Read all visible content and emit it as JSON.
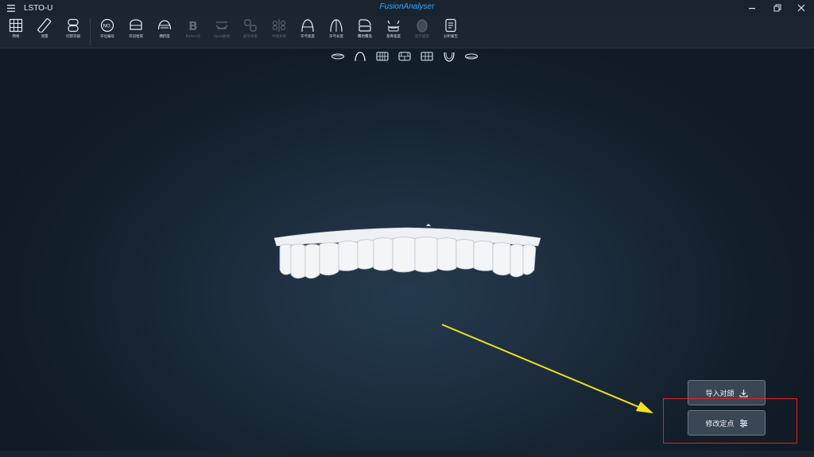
{
  "window": {
    "title": "LSTO-U",
    "brand": "FusionAnalyser",
    "controls": [
      "minimize-icon",
      "restore-icon",
      "close-icon"
    ]
  },
  "toolbar": {
    "items": [
      {
        "label": "网格",
        "icon": "grid-icon",
        "enabled": true
      },
      {
        "label": "测量",
        "icon": "ruler-icon",
        "enabled": true
      },
      {
        "label": "切割牙龈",
        "icon": "cut-gum-icon",
        "enabled": true
      },
      {
        "label": "牙位编号",
        "icon": "tooth-number-icon",
        "enabled": true
      },
      {
        "label": "牙冠拾取",
        "icon": "crown-pick-icon",
        "enabled": true
      },
      {
        "label": "拥挤度",
        "icon": "crowding-icon",
        "enabled": true
      },
      {
        "label": "Bolton比",
        "icon": "bolton-icon",
        "enabled": false
      },
      {
        "label": "Spee曲线",
        "icon": "spee-curve-icon",
        "enabled": false
      },
      {
        "label": "磨牙关系",
        "icon": "molar-relation-icon",
        "enabled": false
      },
      {
        "label": "中线关系",
        "icon": "midline-icon",
        "enabled": false
      },
      {
        "label": "牙弓宽度",
        "icon": "arch-width-icon",
        "enabled": true
      },
      {
        "label": "牙弓长度",
        "icon": "arch-length-icon",
        "enabled": true
      },
      {
        "label": "覆殆覆盖",
        "icon": "overbite-icon",
        "enabled": true
      },
      {
        "label": "基骨弧度",
        "icon": "basal-bone-icon",
        "enabled": true
      },
      {
        "label": "显示面部",
        "icon": "face-icon",
        "enabled": false
      },
      {
        "label": "分析报告",
        "icon": "report-icon",
        "enabled": true
      }
    ]
  },
  "views": [
    "view-bottom-icon",
    "view-arch-icon",
    "view-front-icon",
    "view-side-icon",
    "view-back-icon",
    "view-occlusal-icon",
    "view-top-icon"
  ],
  "actions": {
    "import_label": "导入对颌",
    "modify_label": "修改定点"
  },
  "colors": {
    "accent": "#35a8ff",
    "highlight": "#e3202a",
    "arrow": "#f2e21c"
  }
}
